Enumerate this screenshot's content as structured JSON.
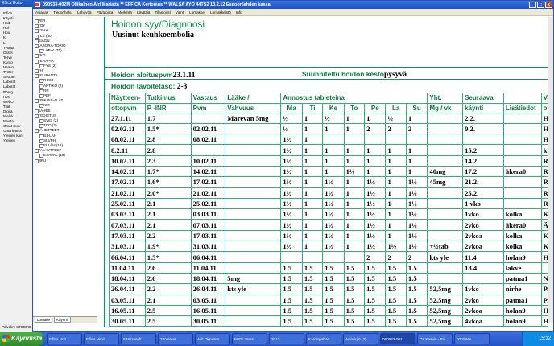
{
  "background_window": {
    "title": "Effica Hoito",
    "tree": [
      "Effica",
      "Käynti",
      "Hoit",
      "Hoi",
      "Hoid",
      "K",
      "L",
      "Työnta",
      "Ossel",
      "Terve",
      "Kunto",
      "Haavo",
      "Työter",
      "Seuran",
      "Laborat",
      "Laborat",
      "Röntg",
      "HV8",
      "WebO",
      "Tilat",
      "Digita",
      "Nieluk",
      "Navita",
      "Omat Suor",
      "Oma kanss",
      "Yleinen kan",
      "Yleinen"
    ],
    "status": "Palvelin: STEEFOH"
  },
  "window": {
    "title": "090933-002M Ollikainen Airi Marjatta  ** EFFICA Kertomus **  WALSA AYO  44TS2  13.2.12  Espoonlahden kassa",
    "menu": [
      "Asiakas",
      "Tiedonhaku",
      "Lehdyttä",
      "Pöytäpirta",
      "Merkintä",
      "Käyttäjä",
      "Tilastointi",
      "Vienti",
      "Lomakket",
      "Lomakkeistö",
      "Info"
    ]
  },
  "nav_tree": [
    {
      "label": "PER",
      "sub": false
    },
    {
      "label": "TOY",
      "sub": false
    },
    {
      "label": "ESHA",
      "sub": false
    },
    {
      "label": "YLE (30)",
      "sub": false
    },
    {
      "label": "DIAGN",
      "sub": false
    },
    {
      "label": "LABORA-TORIO",
      "sub": false
    },
    {
      "label": "LAB-Y (31)",
      "sub": true
    },
    {
      "label": "EKG",
      "sub": false
    },
    {
      "label": "TERAPIA",
      "sub": false
    },
    {
      "label": "FYS (2)",
      "sub": true
    },
    {
      "label": "TH",
      "sub": false
    },
    {
      "label": "SEURANTA",
      "sub": false
    },
    {
      "label": "ROS2",
      "sub": true
    },
    {
      "label": "ANTIKO (2)",
      "sub": true
    },
    {
      "label": "RR",
      "sub": true
    },
    {
      "label": "PEF",
      "sub": true
    },
    {
      "label": "ERIKOIS-ALAT",
      "sub": false
    },
    {
      "label": "KIR",
      "sub": true
    },
    {
      "label": "SÄHES",
      "sub": false
    },
    {
      "label": "TODISTUS",
      "sub": false
    },
    {
      "label": "SV67 (2)",
      "sub": true
    },
    {
      "label": "TOD (2)",
      "sub": true
    },
    {
      "label": "LÄHETTEET",
      "sub": false
    },
    {
      "label": "B1-LÄH",
      "sub": true
    },
    {
      "label": "SIS/PH",
      "sub": true
    },
    {
      "label": "ELLÄH (12)",
      "sub": true
    },
    {
      "label": "PALAUTTEET",
      "sub": false
    },
    {
      "label": "ESAPAL (16)",
      "sub": true
    },
    {
      "label": "MPU",
      "sub": false
    }
  ],
  "nav_tabs": [
    "Lomake",
    "Käynnit"
  ],
  "doc": {
    "title": "Hoidon syy/Diagnoosi",
    "subtitle": "Uusinut keuhkoembolia",
    "start_label": "Hoidon aloituspvm",
    "start_value": "23.1.11",
    "duration_label": "Suunniteltu hoidon kesto",
    "duration_value": "pysyvä",
    "target_label": "Hoidon tavoitetaso:",
    "target_value": "2-3"
  },
  "table": {
    "header1": [
      "Näytteen-",
      "Tutkimus",
      "Vastaus",
      "Lääke /",
      "Annostus tableteina",
      "Yht.",
      "Seuraava",
      "Va"
    ],
    "header2": [
      "ottopvm",
      "P -INR",
      "Pvm",
      "Vahvuus",
      "Ma",
      "Ti",
      "Ke",
      "To",
      "Pe",
      "La",
      "Su",
      "Mg / vk",
      "käynti",
      "Lisätiedot",
      "ot"
    ],
    "rows": [
      [
        "27.1.11",
        "1.7",
        "",
        "Marevan 5mg",
        "½",
        "1",
        "½",
        "1",
        "1",
        "½",
        "1",
        "",
        "2.2.",
        "",
        "HA"
      ],
      [
        "02.02.11",
        "1.5*",
        "02.02.11",
        "",
        "½",
        "1",
        "1",
        "1",
        "2",
        "2",
        "2",
        "",
        "9.2.",
        "",
        "HA"
      ],
      [
        "08.02.11",
        "2.8",
        "08.02.11",
        "",
        "1½",
        "1",
        "",
        "",
        "",
        "",
        "",
        "",
        "",
        "",
        "HA"
      ],
      [
        "8.2.11",
        "2.8",
        "",
        "",
        "1½",
        "1",
        "1",
        "1",
        "1",
        "1",
        "1",
        "",
        "15.2",
        "",
        "kts"
      ],
      [
        "10.02.11",
        "2.3",
        "10.02.11",
        "",
        "1½",
        "1",
        "1",
        "1",
        "1",
        "1",
        "1",
        "",
        "14.2",
        "",
        "RI"
      ],
      [
        "14.02.11",
        "1.7*",
        "14.02.11",
        "",
        "1½",
        "1",
        "1",
        "1½",
        "1",
        "1",
        "1",
        "40mg",
        "17.2",
        "äkera0",
        "RI"
      ],
      [
        "17.02.11",
        "1.6*",
        "17.02.11",
        "",
        "1½",
        "1",
        "1½",
        "1",
        "1½",
        "1",
        "1½",
        "45mg",
        "21.2.",
        "",
        "RI"
      ],
      [
        "21.02.11",
        "2.0*",
        "21.02.11",
        "",
        "1½",
        "1",
        "1½",
        "1",
        "1½",
        "1",
        "1½",
        "",
        "25.2.",
        "",
        "RI"
      ],
      [
        "25.02.11",
        "2.1",
        "25.02.11",
        "",
        "1½",
        "1",
        "1½",
        "1",
        "1½",
        "1",
        "1½",
        "",
        "1 vko",
        "",
        "RI"
      ],
      [
        "03.03.11",
        "2.1",
        "03.03.11",
        "",
        "1½",
        "1",
        "1½",
        "1",
        "1½",
        "1",
        "1½",
        "",
        "1vko",
        "kolka",
        "KC"
      ],
      [
        "07.03.11",
        "2.1",
        "07.03.11",
        "",
        "1½",
        "1",
        "1½",
        "1",
        "1½",
        "1",
        "1½",
        "",
        "2vko",
        "äkera0",
        "ÄF"
      ],
      [
        "17.03.11",
        "2.2",
        "17.03.11",
        "",
        "1½",
        "1",
        "1½",
        "1",
        "1½",
        "1",
        "1½",
        "",
        "2vkoa",
        "kolka",
        "KC"
      ],
      [
        "31.03.11",
        "1.9*",
        "31.03.11",
        "",
        "1½",
        "1",
        "1½",
        "1",
        "1½",
        "1½",
        "1½",
        "+½tab",
        "2vkoa",
        "kolka",
        "KC"
      ],
      [
        "06.04.11",
        "1.5*",
        "06.04.11",
        "",
        "",
        "",
        "",
        "",
        "2",
        "2",
        "2",
        "kts yle",
        "11.4",
        "holan9",
        "HC"
      ],
      [
        "11.04.11",
        "2.6",
        "11.04.11",
        "",
        "1.5",
        "1.5",
        "1.5",
        "1.5",
        "1.5",
        "1.5",
        "1.5",
        "",
        "18.4",
        "lakve",
        ""
      ],
      [
        "18.04.11",
        "2.6",
        "18.04.11",
        "5mg",
        "1.5",
        "1.5",
        "1.5",
        "1.5",
        "1.5",
        "1.5",
        "1.5",
        "",
        "",
        "patma1",
        "NI"
      ],
      [
        "26.04.11",
        "2.2",
        "26.04.11",
        "kts yle",
        "1.5",
        "1.5",
        "1.5",
        "1.5",
        "1.5",
        "1.5",
        "1.5",
        "52,5mg",
        "1vko",
        "nirhe",
        "PA"
      ],
      [
        "03.05.11",
        "2.1",
        "03.05.11",
        "",
        "1.5",
        "1.5",
        "1.5",
        "1.5",
        "1.5",
        "1.5",
        "1.5",
        "52,5mg",
        "2vko",
        "patma1",
        "PA"
      ],
      [
        "16.05.11",
        "2.5",
        "16.05.11",
        "",
        "1.5",
        "1.5",
        "1.5",
        "1.5",
        "1.5",
        "1.5",
        "1.5",
        "52,5mg",
        "2vkoa",
        "holan9",
        "HC"
      ],
      [
        "30.05.11",
        "2.5",
        "30.05.11",
        "",
        "1.5",
        "1.5",
        "1.5",
        "1.5",
        "1.5",
        "1.5",
        "1.5",
        "52,5mg",
        "4vkoa",
        "holan9",
        "HC"
      ]
    ]
  },
  "taskbar": {
    "start": "Käynnistä",
    "tasks": [
      "Effica Hoit",
      "Effica Nimiii",
      "5 Microsoft",
      "3 Internet",
      "Avit Oksanen",
      "Mirttu Tams",
      "2012",
      "Kardiopahac",
      "Asiakirjat (3)",
      "090933-002",
      "On Kaavio - Pai",
      "00 Yhtee"
    ],
    "clock": "15:32"
  }
}
